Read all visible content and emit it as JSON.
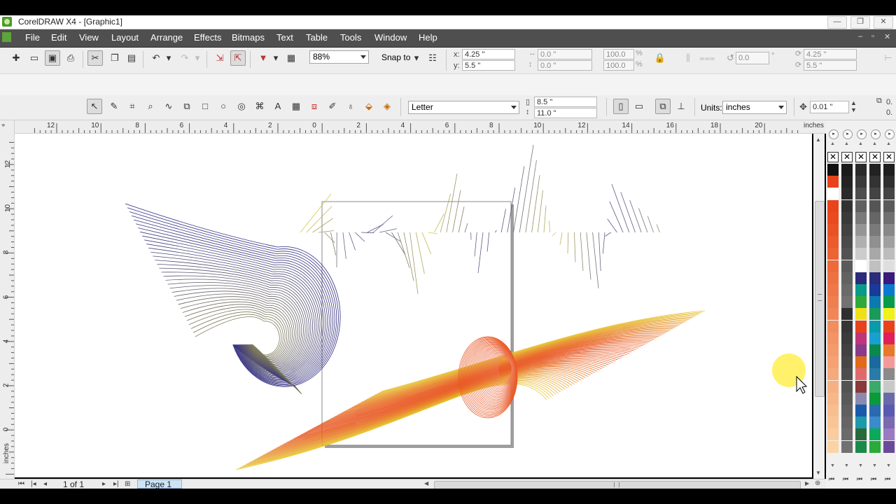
{
  "window": {
    "title": "CorelDRAW X4 - [Graphic1]",
    "controls": [
      "—",
      "❐",
      "✕"
    ]
  },
  "menu": {
    "items": [
      "File",
      "Edit",
      "View",
      "Layout",
      "Arrange",
      "Effects",
      "Bitmaps",
      "Text",
      "Table",
      "Tools",
      "Window",
      "Help"
    ],
    "doc_controls": [
      "–",
      "▫",
      "✕"
    ]
  },
  "standard_toolbar": {
    "zoom_value": "88%",
    "snap_label": "Snap to"
  },
  "property_bar": {
    "x_label": "x:",
    "y_label": "y:",
    "x_value": "4.25 \"",
    "y_value": "5.5 \"",
    "width_value": "0.0 \"",
    "height_value": "0.0 \"",
    "scale_x": "100.0",
    "scale_y": "100.0",
    "pct": "%",
    "rotation_value": "0.0",
    "degree": "°",
    "center_x": "4.25 \"",
    "center_y": "5.5 \"",
    "paper_type": "Letter",
    "page_width": "8.5 \"",
    "page_height": "11.0 \"",
    "units_label": "Units:",
    "units_value": "inches",
    "nudge_value": "0.01 \"",
    "clipped_values": [
      "0.",
      "0."
    ]
  },
  "rulers": {
    "unit": "inches",
    "h_ticks": [
      "12",
      "10",
      "8",
      "6",
      "4",
      "2",
      "0",
      "2",
      "4",
      "6",
      "8",
      "10",
      "12",
      "14",
      "16",
      "18",
      "20"
    ],
    "v_ticks": [
      "12",
      "10",
      "8",
      "6",
      "4",
      "2",
      "0"
    ],
    "v_unit": "inches"
  },
  "page_nav": {
    "counter": "1 of 1",
    "page_tab": "Page 1"
  },
  "colors": {
    "menubar": "#4f4f4f",
    "canvas": "#ffffff",
    "blue_blend": "#2e2a84",
    "yellow_blend": "#e6e22a",
    "orange_blend": "#e8541e",
    "highlight": "#fff05a"
  },
  "palette_columns": [
    [
      "#111111",
      "#e8421a",
      "#ffffff",
      "#e9441b",
      "#e94a20",
      "#ea5226",
      "#eb5b2d",
      "#ec6334",
      "#ed6a3b",
      "#ee7142",
      "#ef7849",
      "#f07f50",
      "#f18657",
      "#f28d5e",
      "#f39465",
      "#f49b6c",
      "#f5a273",
      "#f6a97a",
      "#f7b081",
      "#f8b788",
      "#f9be8f",
      "#fac596",
      "#fbcc9d",
      "#fcd3a4"
    ],
    [
      "#1b1b1b",
      "#222222",
      "#2a2a2a",
      "#323232",
      "#3a3a3a",
      "#424242",
      "#4a4a4a",
      "#525252",
      "#5a5a5a",
      "#626262",
      "#6a6a6a",
      "#727272",
      "#2f2f2f",
      "#353535",
      "#3b3b3b",
      "#414141",
      "#474747",
      "#4d4d4d",
      "#535353",
      "#595959",
      "#5f5f5f",
      "#656565",
      "#6b6b6b",
      "#717171"
    ],
    [
      "#2a2a2a",
      "#3a3a3a",
      "#4d4d4d",
      "#606060",
      "#7a7a7a",
      "#959595",
      "#b0b0b0",
      "#cccccc",
      "#ffffff",
      "#2c2a7a",
      "#0a9a8a",
      "#2faa3a",
      "#f0e01a",
      "#e8421a",
      "#c0357a",
      "#8a3a8a",
      "#e06a1a",
      "#e06a6a",
      "#8a3a3a",
      "#8a8ab0",
      "#1a5aaa",
      "#1a9aaa",
      "#2a6a3a",
      "#1a8a4a"
    ],
    [
      "#222222",
      "#333333",
      "#444444",
      "#555555",
      "#666666",
      "#7a7a7a",
      "#909090",
      "#a8a8a8",
      "#c0c0c0",
      "#2c2a7a",
      "#1a3a9a",
      "#0a7ab0",
      "#1a9a5a",
      "#0a9aaa",
      "#1aa0d0",
      "#0a8a4a",
      "#1a6aa0",
      "#2a7aaa",
      "#3aaa6a",
      "#0a9a3a",
      "#2a6ab0",
      "#3a8acc",
      "#0aaa5a",
      "#2aaa3a"
    ],
    [
      "#1e1e1e",
      "#2e2e2e",
      "#444444",
      "#5a5a5a",
      "#707070",
      "#888888",
      "#a0a0a0",
      "#bcbcbc",
      "#dedede",
      "#3a1a7a",
      "#0a7ad0",
      "#0a9a4a",
      "#f0f01a",
      "#e8421a",
      "#e0205a",
      "#e8782a",
      "#f29a9a",
      "#8a8a8a",
      "#c8c8c8",
      "#6a6aaa",
      "#5a5ab0",
      "#7a6ab0",
      "#9a7ac0",
      "#6a4a9a"
    ]
  ]
}
